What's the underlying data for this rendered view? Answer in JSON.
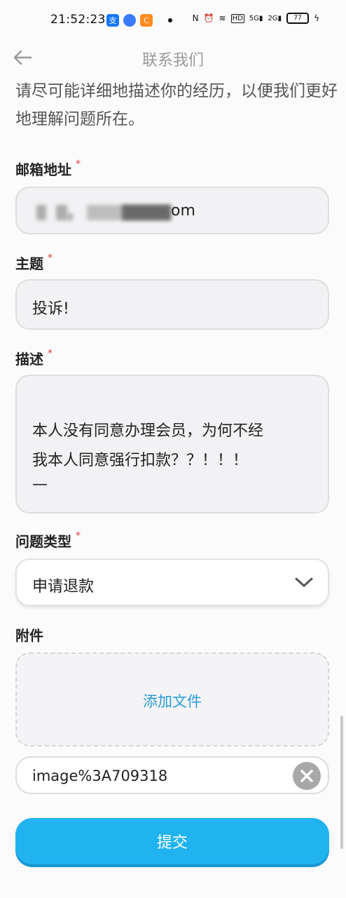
{
  "status_bar": {
    "time": "21:52:23",
    "battery": "77",
    "net1": "5G",
    "net2": "2G",
    "icons": [
      "alipay-icon",
      "app-icon",
      "app-icon-2",
      "nfc-icon",
      "alarm-icon",
      "wifi-icon",
      "hd-icon",
      "signal-icon",
      "battery-icon",
      "charging-icon"
    ]
  },
  "header": {
    "title": "联系我们"
  },
  "intro": "请尽可能详细地描述你的经历，以便我们更好地理解问题所在。",
  "email": {
    "label": "邮箱地址",
    "required_mark": "*",
    "value_suffix": "om"
  },
  "subject": {
    "label": "主题",
    "required_mark": "*",
    "value": "投诉!"
  },
  "description": {
    "label": "描述",
    "required_mark": "*",
    "value_line1": "本人没有同意办理会员，为何不经",
    "value_line2": "我本人同意强行扣款？？！！！",
    "value_line3": "—"
  },
  "issue_type": {
    "label": "问题类型",
    "required_mark": "*",
    "selected": "申请退款"
  },
  "attachment": {
    "label": "附件",
    "add_label": "添加文件",
    "file_name": "image%3A709318"
  },
  "submit_label": "提交",
  "colors": {
    "accent": "#21b3f0",
    "link": "#2a9bd6",
    "required": "#d94040"
  }
}
